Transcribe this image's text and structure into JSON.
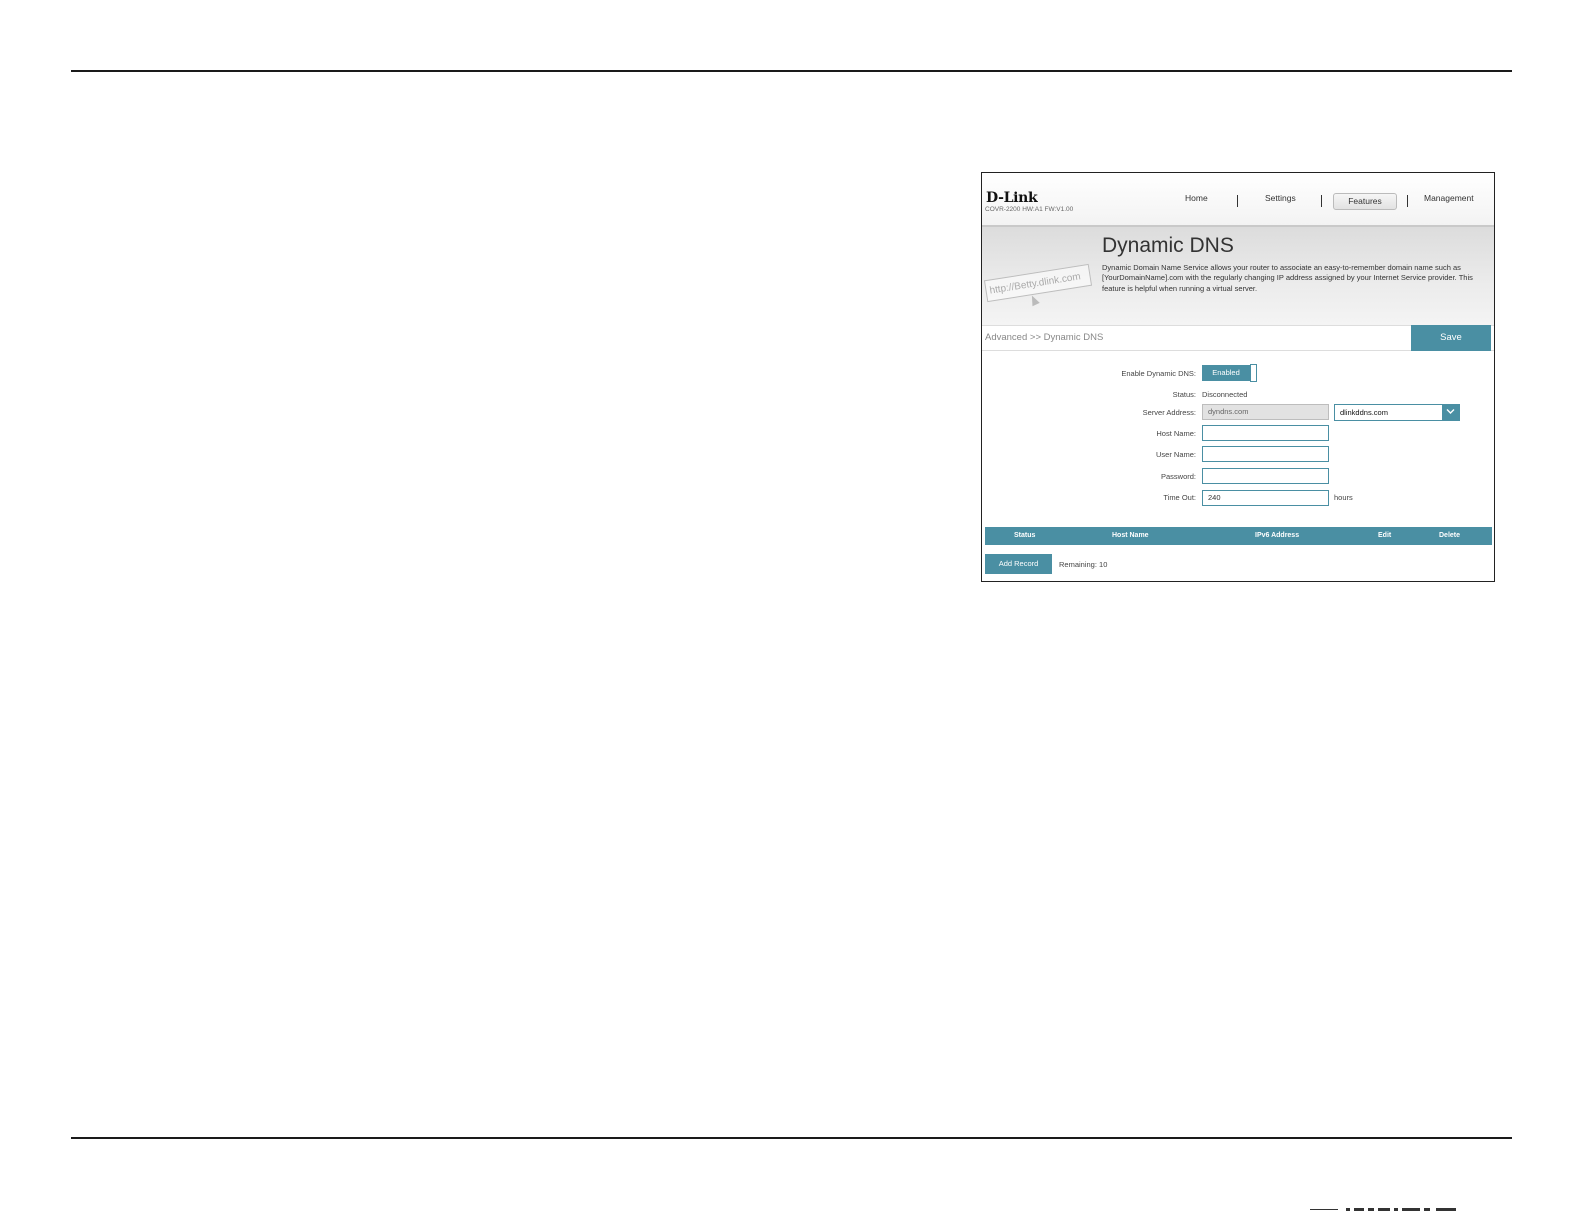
{
  "app": {
    "brand": "D-Link",
    "model": "COVR-2200 HW:A1 FW:V1.00"
  },
  "nav": {
    "items": [
      {
        "label": "Home"
      },
      {
        "label": "Settings"
      },
      {
        "label": "Features"
      },
      {
        "label": "Management"
      }
    ],
    "active": "Features"
  },
  "banner": {
    "title": "Dynamic DNS",
    "description": "Dynamic Domain Name Service allows your router to associate an easy-to-remember domain name such as [YourDomainName].com with the regularly changing IP address assigned by your Internet Service provider. This feature is helpful when running a virtual server.",
    "art_text": "http://Betty.dlink.com"
  },
  "breadcrumb": "Advanced >> Dynamic DNS",
  "toolbar": {
    "save_label": "Save"
  },
  "form": {
    "enable_label": "Enable Dynamic DNS:",
    "enable_value": "Enabled",
    "status_label": "Status:",
    "status_value": "Disconnected",
    "server_label": "Server Address:",
    "server_value": "dyndns.com",
    "server_select_value": "dlinkddns.com",
    "host_label": "Host Name:",
    "host_value": "",
    "user_label": "User Name:",
    "user_value": "",
    "password_label": "Password:",
    "password_value": "",
    "timeout_label": "Time Out:",
    "timeout_value": "240",
    "timeout_units": "hours"
  },
  "table": {
    "columns": [
      "Status",
      "Host Name",
      "IPv6 Address",
      "Edit",
      "Delete"
    ],
    "rows": []
  },
  "records": {
    "add_label": "Add Record",
    "remaining": "Remaining: 10"
  },
  "colors": {
    "accent": "#4a8fa3"
  }
}
